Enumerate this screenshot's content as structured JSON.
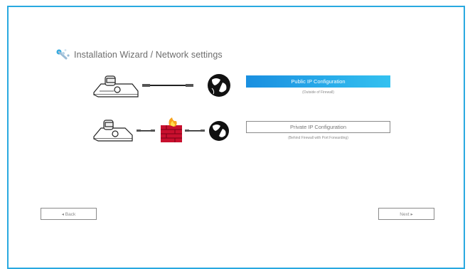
{
  "wizard": {
    "title": "Installation Wizard / Network settings",
    "accent_color": "#29a9e0"
  },
  "options": {
    "public": {
      "label": "Public IP Configuration",
      "note": "(Outside of Firewall)"
    },
    "private": {
      "label": "Private IP Configuration",
      "note": "(Behind Firewall with Port Forwarding)"
    }
  },
  "nav": {
    "back_label": "◂ Back",
    "next_label": "Next ▸"
  },
  "icons": [
    "wizard-icon",
    "camera-icon",
    "cable-icon",
    "globe-icon",
    "firewall-icon"
  ]
}
